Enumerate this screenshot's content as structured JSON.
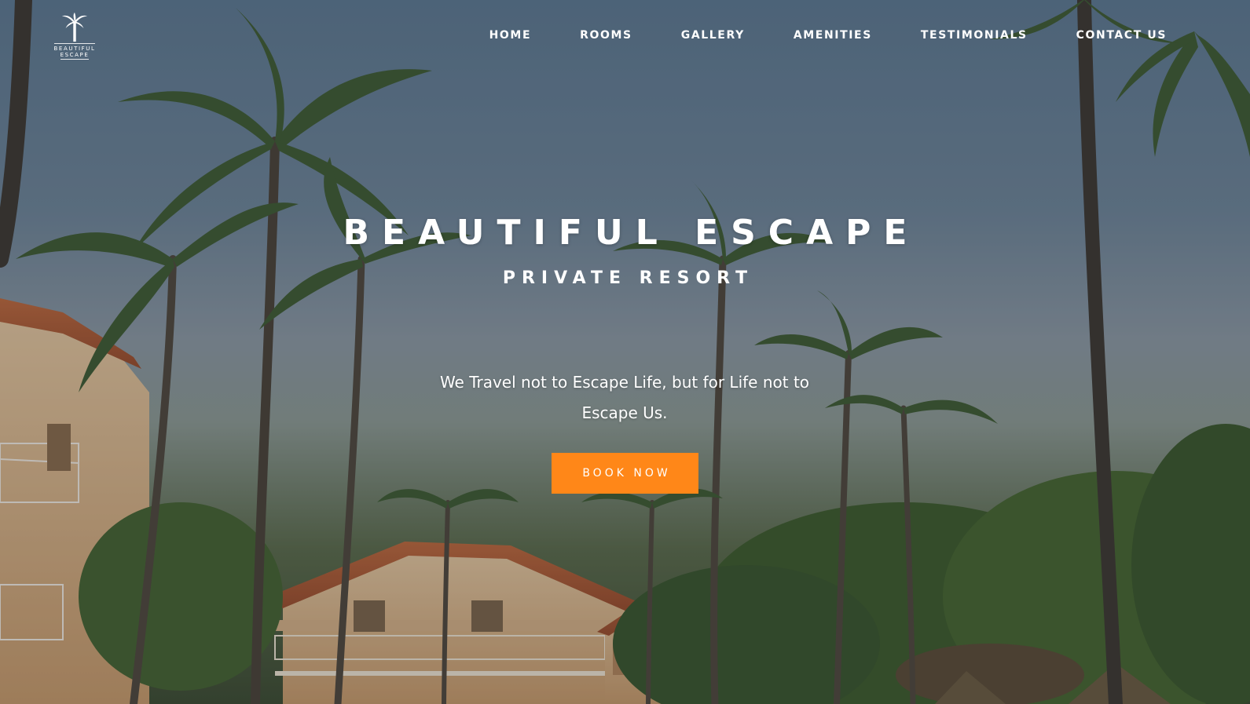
{
  "brand": {
    "logo_line_1": "BEAUTIFUL",
    "logo_line_2": "ESCAPE",
    "logo_icon": "palm-tree-icon"
  },
  "nav": {
    "items": [
      {
        "label": "HOME"
      },
      {
        "label": "ROOMS"
      },
      {
        "label": "GALLERY"
      },
      {
        "label": "AMENITIES"
      },
      {
        "label": "TESTIMONIALS"
      },
      {
        "label": "CONTACT US"
      }
    ]
  },
  "hero": {
    "title": "BEAUTIFUL ESCAPE",
    "subtitle": "PRIVATE RESORT",
    "tagline": "We Travel not to Escape Life, but for Life not to Escape Us.",
    "cta_label": "BOOK NOW",
    "background": "resort-with-palm-trees-photo"
  },
  "colors": {
    "accent": "#ff8718",
    "text": "#ffffff"
  }
}
